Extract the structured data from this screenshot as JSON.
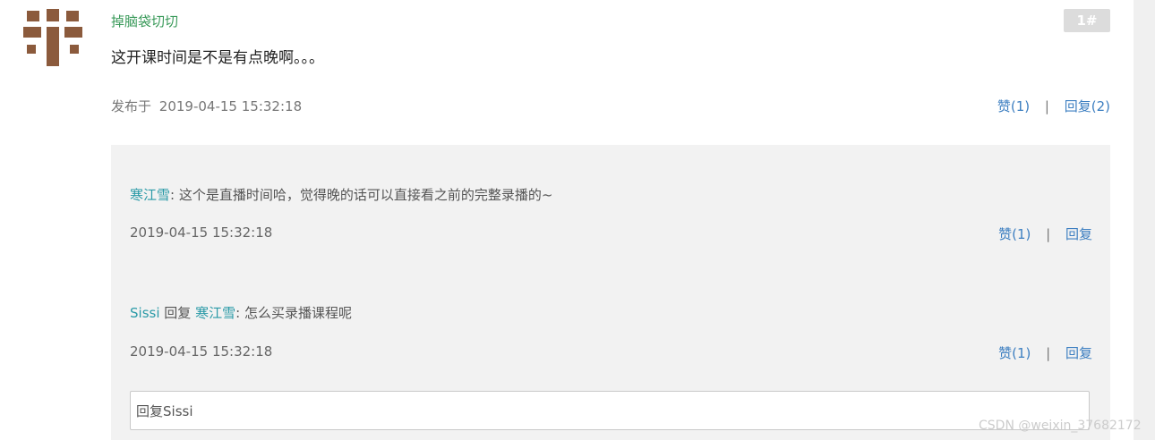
{
  "comment": {
    "username": "掉脑袋切切",
    "floor": "1#",
    "content": "这开课时间是不是有点晚啊。。。",
    "posted_prefix": "发布于",
    "posted_time": "2019-04-15 15:32:18",
    "like_label": "赞(1)",
    "separator": "|",
    "reply_label": "回复(2)"
  },
  "replies": [
    {
      "author": "寒江雪",
      "colon": ":",
      "text": "这个是直播时间哈，觉得晚的话可以直接看之前的完整录播的~",
      "time": "2019-04-15 15:32:18",
      "like_label": "赞(1)",
      "separator": "|",
      "reply_label": "回复"
    },
    {
      "author": "Sissi",
      "reply_word": "回复",
      "target": "寒江雪",
      "colon": ":",
      "text": "怎么买录播课程呢",
      "time": "2019-04-15 15:32:18",
      "like_label": "赞(1)",
      "separator": "|",
      "reply_label": "回复"
    }
  ],
  "reply_input": {
    "placeholder": "回复Sissi"
  },
  "watermark": "CSDN @weixin_37682172",
  "colors": {
    "username": "#3a9a5a",
    "link": "#3d7fc1",
    "reply_name": "#2a9aa7",
    "avatar": "#8b5a3c"
  }
}
